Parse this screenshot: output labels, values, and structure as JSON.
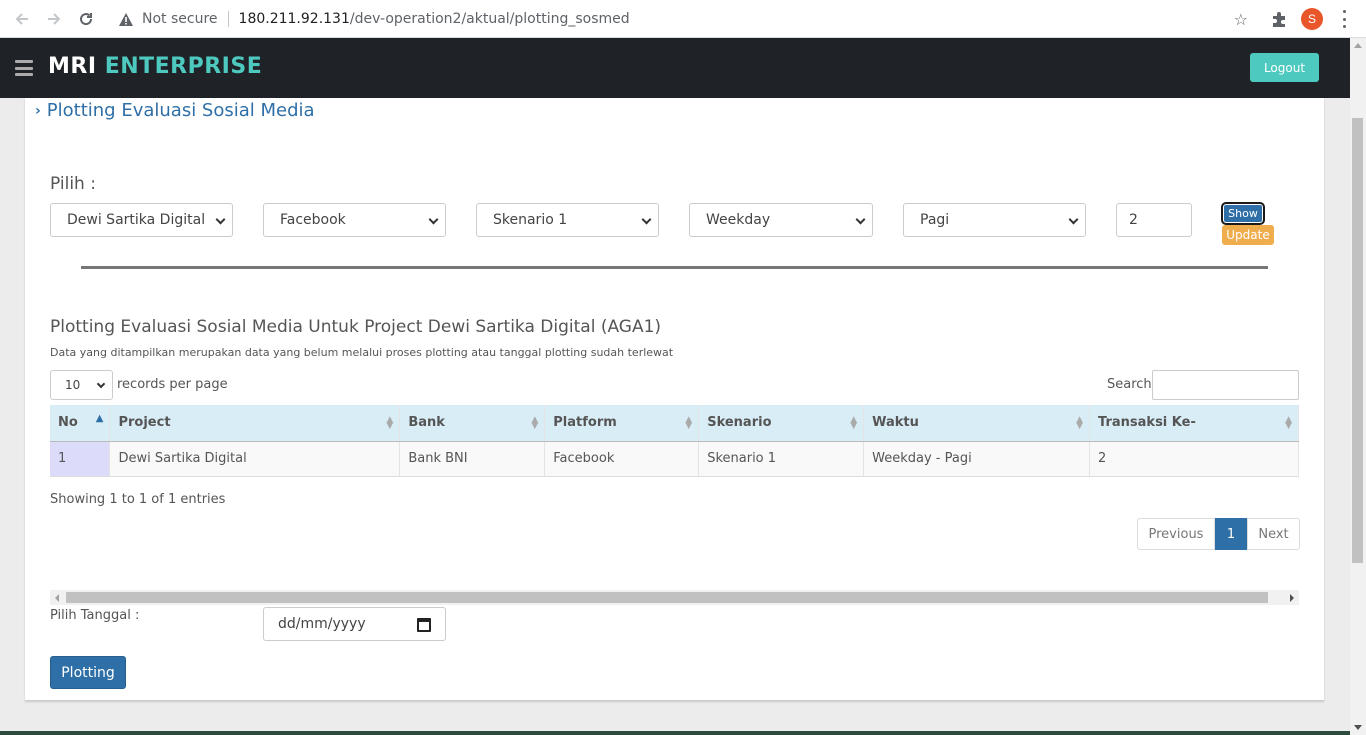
{
  "browser": {
    "security_label": "Not secure",
    "url_host": "180.211.92.131",
    "url_path": "/dev-operation2/aktual/plotting_sosmed",
    "profile_initial": "S"
  },
  "header": {
    "brand_part1": "MRI",
    "brand_part2": "ENTERPRISE",
    "logout_label": "Logout"
  },
  "page": {
    "title": "Plotting Evaluasi Sosial Media"
  },
  "filters": {
    "label": "Pilih :",
    "project": "Dewi Sartika Digital",
    "platform": "Facebook",
    "skenario": "Skenario 1",
    "day": "Weekday",
    "time": "Pagi",
    "transaksi": "2",
    "show_label": "Show",
    "update_label": "Update"
  },
  "section": {
    "title": "Plotting Evaluasi Sosial Media Untuk Project Dewi Sartika Digital (AGA1)",
    "subtitle": "Data yang ditampilkan merupakan data yang belum melalui proses plotting atau tanggal plotting sudah terlewat"
  },
  "table_controls": {
    "length_value": "10",
    "length_label": "records per page",
    "search_label": "Search:"
  },
  "table": {
    "columns": [
      "No",
      "Project",
      "Bank",
      "Platform",
      "Skenario",
      "Waktu",
      "Transaksi Ke-"
    ],
    "rows": [
      [
        "1",
        "Dewi Sartika Digital",
        "Bank BNI",
        "Facebook",
        "Skenario 1",
        "Weekday - Pagi",
        "2"
      ]
    ]
  },
  "pagination": {
    "info": "Showing 1 to 1 of 1 entries",
    "previous": "Previous",
    "current": "1",
    "next": "Next"
  },
  "plotting": {
    "date_label": "Pilih Tanggal :",
    "date_placeholder": "dd/mm/yyyy",
    "button_label": "Plotting"
  }
}
